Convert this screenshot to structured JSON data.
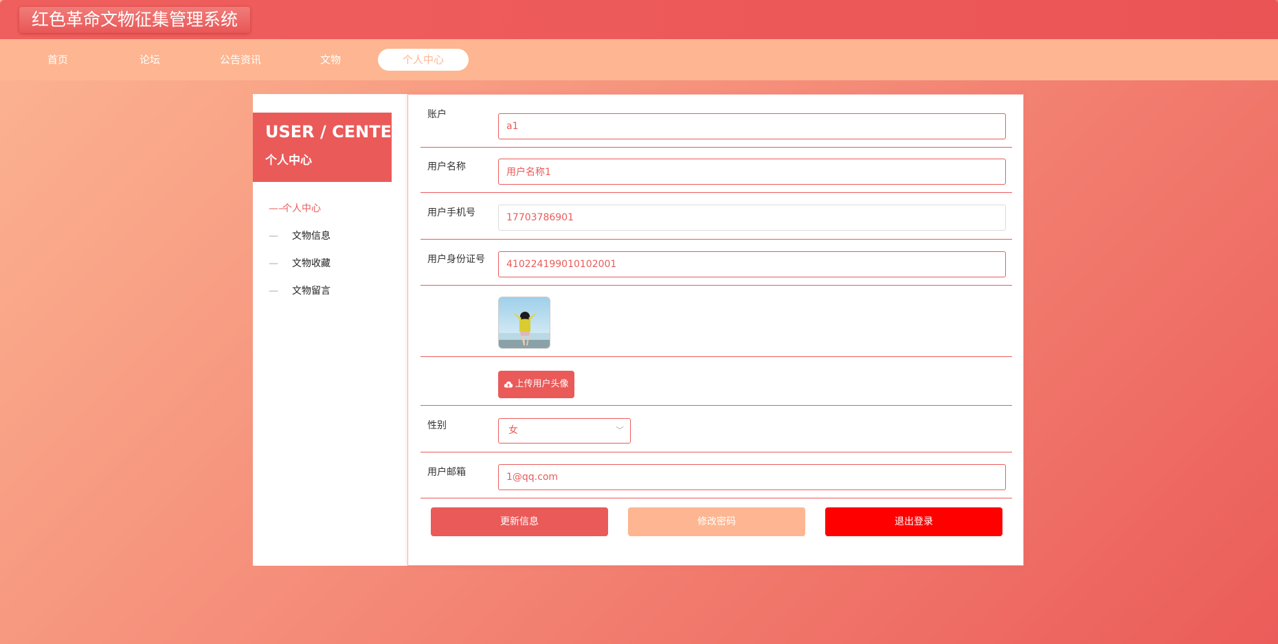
{
  "app": {
    "title": "红色革命文物征集管理系统"
  },
  "nav": {
    "items": [
      "首页",
      "论坛",
      "公告资讯",
      "文物",
      "个人中心"
    ],
    "active": "个人中心"
  },
  "sidebar": {
    "title_en": "USER / CENTER",
    "title_cn": "个人中心",
    "items": [
      {
        "label": "个人中心",
        "active": true
      },
      {
        "label": "文物信息",
        "active": false
      },
      {
        "label": "文物收藏",
        "active": false
      },
      {
        "label": "文物留言",
        "active": false
      }
    ]
  },
  "form": {
    "account": {
      "label": "账户",
      "value": "a1"
    },
    "username": {
      "label": "用户名称",
      "value": "用户名称1"
    },
    "phone": {
      "label": "用户手机号",
      "value": "17703786901"
    },
    "id_number": {
      "label": "用户身份证号",
      "value": "410224199010102001"
    },
    "avatar": {
      "icon": "user-photo"
    },
    "upload": {
      "label": "上传用户头像",
      "icon": "cloud-upload-icon"
    },
    "gender": {
      "label": "性别",
      "value": "女"
    },
    "email": {
      "label": "用户邮箱",
      "value": "1@qq.com"
    }
  },
  "actions": {
    "update": "更新信息",
    "change_password": "修改密码",
    "logout": "退出登录"
  },
  "colors": {
    "primary": "#ea5a59",
    "secondary": "#fdb691",
    "danger": "#ff0000"
  }
}
